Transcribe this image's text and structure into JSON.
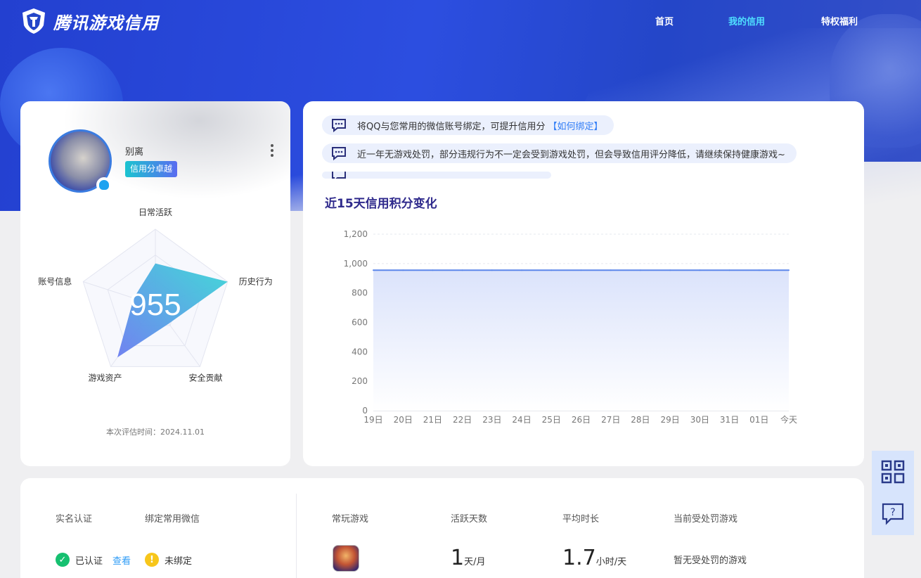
{
  "header": {
    "brand": "腾讯游戏信用",
    "nav": [
      {
        "label": "首页",
        "active": false
      },
      {
        "label": "我的信用",
        "active": true
      },
      {
        "label": "特权福利",
        "active": false
      }
    ]
  },
  "profile": {
    "nickname": "别离",
    "credit_level": "信用分卓越",
    "score": "955",
    "radar": {
      "dimensions": [
        "日常活跃",
        "历史行为",
        "安全贡献",
        "游戏资产",
        "账号信息"
      ],
      "values": [
        0.55,
        1.0,
        0.3,
        0.85,
        0.3
      ]
    },
    "eval_time": "本次评估时间：2024.11.01"
  },
  "notices": [
    {
      "text": "将QQ与您常用的微信账号绑定，可提升信用分",
      "link": "【如何绑定】"
    },
    {
      "text": "近一年无游戏处罚，部分违规行为不一定会受到游戏处罚，但会导致信用评分降低，请继续保持健康游戏~",
      "link": ""
    }
  ],
  "chart_title": "近15天信用积分变化",
  "chart_data": {
    "type": "area",
    "title": "近15天信用积分变化",
    "categories": [
      "19日",
      "20日",
      "21日",
      "22日",
      "23日",
      "24日",
      "25日",
      "26日",
      "27日",
      "28日",
      "29日",
      "30日",
      "31日",
      "01日",
      "今天"
    ],
    "series": [
      {
        "values": [
          955,
          955,
          955,
          955,
          955,
          955,
          955,
          955,
          955,
          955,
          955,
          955,
          955,
          955,
          955
        ]
      }
    ],
    "yticks": [
      "0",
      "200",
      "400",
      "600",
      "800",
      "1,000",
      "1,200"
    ],
    "ylim": [
      0,
      1200
    ],
    "grid": true
  },
  "account": {
    "realname_label": "实名认证",
    "wechat_label": "绑定常用微信",
    "realname_status": "已认证",
    "view_link": "查看",
    "wechat_status": "未绑定"
  },
  "games": {
    "frequent_label": "常玩游戏",
    "active_days_label": "活跃天数",
    "avg_time_label": "平均时长",
    "punished_label": "当前受处罚游戏",
    "active_days_value": "1",
    "active_days_unit": "天/月",
    "avg_time_value": "1.7",
    "avg_time_unit": "小时/天",
    "punished_value": "暂无受处罚的游戏"
  },
  "colors": {
    "brand_blue": "#2446c8",
    "nav_active": "#4fe0ff",
    "chart_line": "#5b86ea",
    "radar_fill_start": "#3ad6d6",
    "radar_fill_end": "#6a7cf0"
  }
}
